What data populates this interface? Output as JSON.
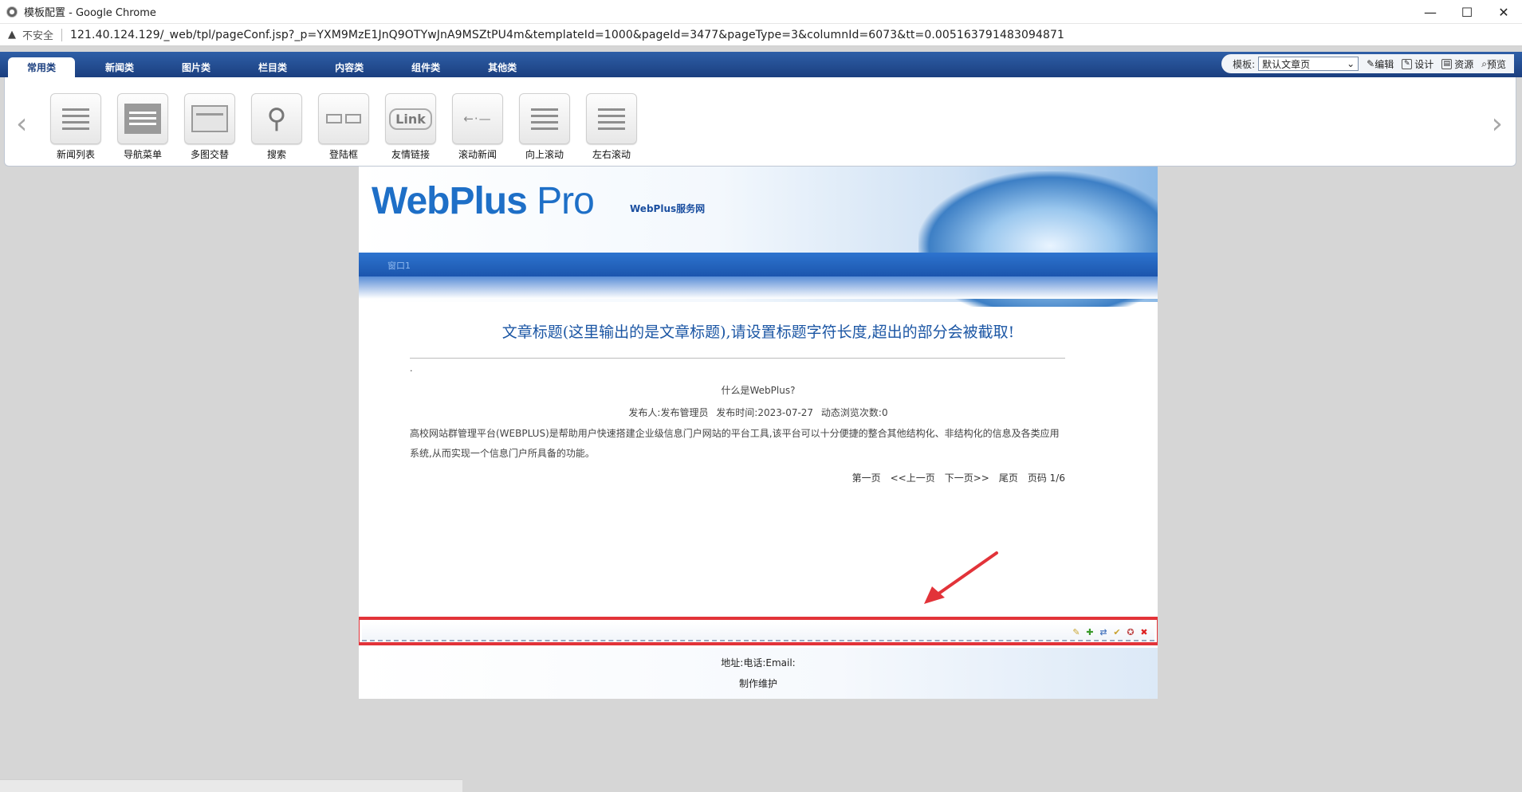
{
  "window": {
    "title": "模板配置 - Google Chrome",
    "minimize": "—",
    "maximize": "☐",
    "close": "✕"
  },
  "address": {
    "warning_icon": "warning-icon",
    "insecure_label": "不安全",
    "url": "121.40.124.129/_web/tpl/pageConf.jsp?_p=YXM9MzE1JnQ9OTYwJnA9MSZtPU4m&templateId=1000&pageId=3477&pageType=3&columnId=6073&tt=0.005163791483094871"
  },
  "editor": {
    "tabs": [
      {
        "label": "常用类",
        "active": true
      },
      {
        "label": "新闻类"
      },
      {
        "label": "图片类"
      },
      {
        "label": "栏目类"
      },
      {
        "label": "内容类"
      },
      {
        "label": "组件类"
      },
      {
        "label": "其他类"
      }
    ],
    "template_label": "模板:",
    "template_value": "默认文章页",
    "tools": [
      "编辑",
      "设计",
      "资源",
      "预览"
    ]
  },
  "widgets": [
    {
      "label": "新闻列表",
      "icon": "list-icon"
    },
    {
      "label": "导航菜单",
      "icon": "menu-icon"
    },
    {
      "label": "多图交替",
      "icon": "image-swap-icon"
    },
    {
      "label": "搜索",
      "icon": "search-icon"
    },
    {
      "label": "登陆框",
      "icon": "login-icon"
    },
    {
      "label": "友情链接",
      "icon": "link-icon"
    },
    {
      "label": "滚动新闻",
      "icon": "scroll-news-icon"
    },
    {
      "label": "向上滚动",
      "icon": "scroll-up-icon"
    },
    {
      "label": "左右滚动",
      "icon": "scroll-horizontal-icon"
    }
  ],
  "page": {
    "logo_main": "WebPlus",
    "logo_suffix": " Pro",
    "service_name": "WebPlus服务网",
    "nav_item": "窗口1",
    "article_title": "文章标题(这里输出的是文章标题),请设置标题字符长度,超出的部分会被截取!",
    "dot": ".",
    "sub_title": "什么是WebPlus?",
    "publisher": "发布人:发布管理员",
    "publish_time": "发布时间:2023-07-27",
    "views": "动态浏览次数:0",
    "body": "高校网站群管理平台(WEBPLUS)是帮助用户快速搭建企业级信息门户网站的平台工具,该平台可以十分便捷的整合其他结构化、非结构化的信息及各类应用系统,从而实现一个信息门户所具备的功能。",
    "pager": {
      "first": "第一页",
      "prev": "<<上一页",
      "next": "下一页>>",
      "last": "尾页",
      "page_info": "页码 1/6"
    },
    "footer_line1": "地址:电话:Email:",
    "footer_line2": "制作维护"
  },
  "column_tools": [
    "pencil-icon",
    "add-icon",
    "move-icon",
    "check-icon",
    "settings-icon",
    "delete-icon"
  ],
  "colors": {
    "brand_blue": "#1e6fc7",
    "tab_bar": "#1b3f7f",
    "highlight_red": "#e23339"
  }
}
